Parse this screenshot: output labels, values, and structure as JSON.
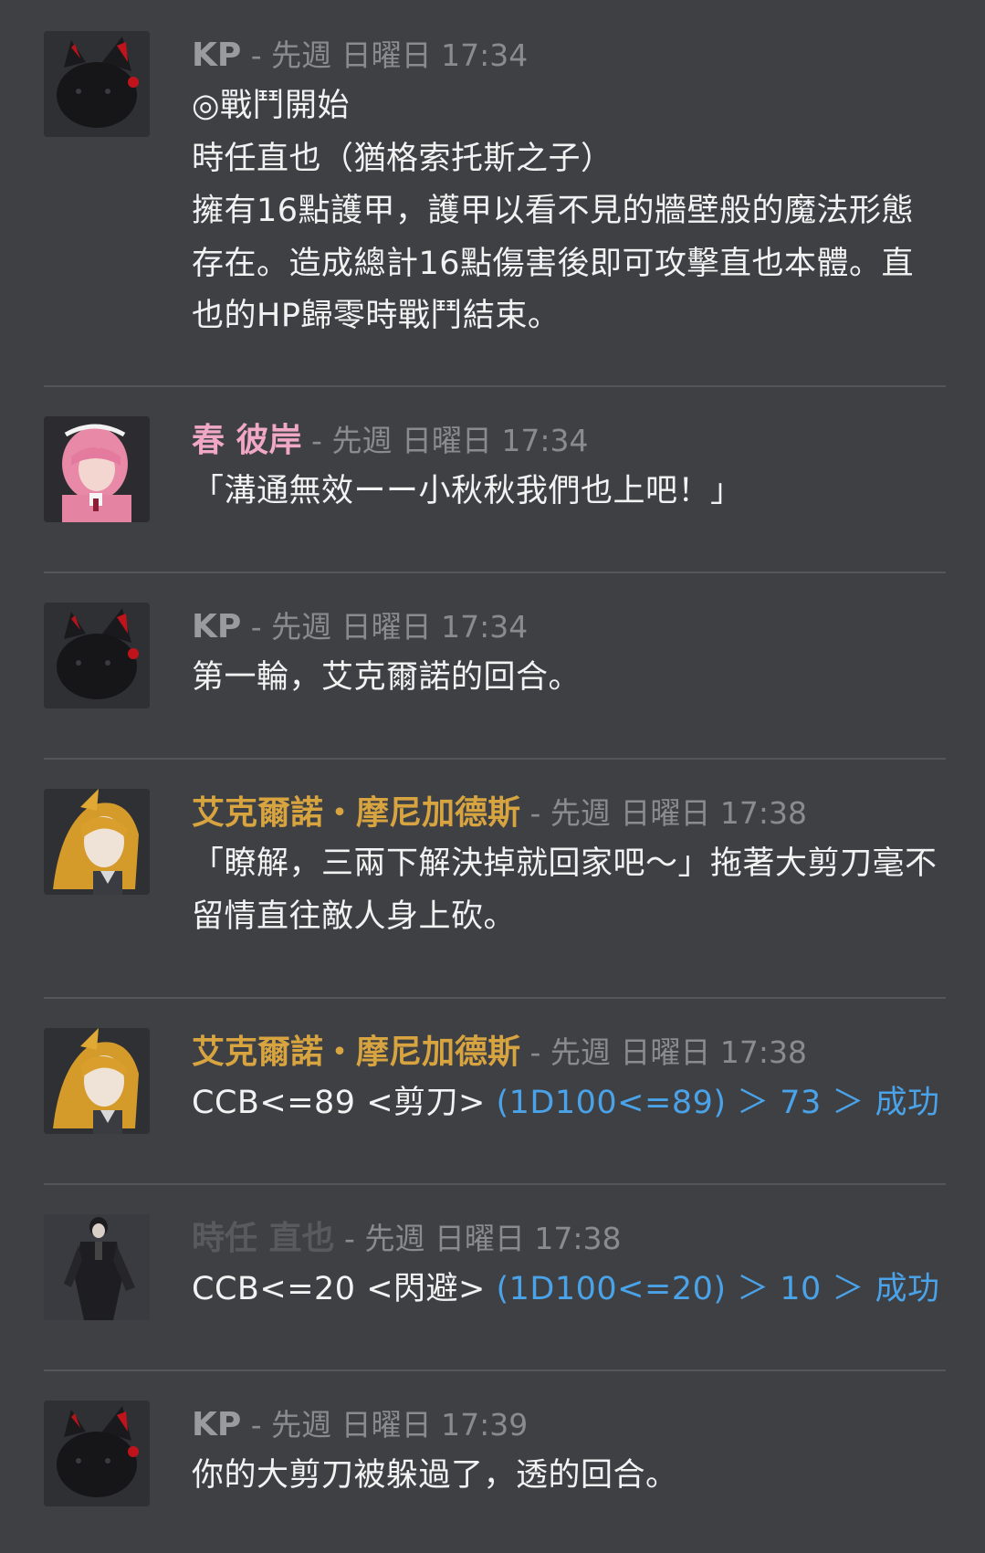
{
  "colors": {
    "background": "#3f4044",
    "divider": "#55565a",
    "kp": "#9a9b9f",
    "haru": "#f1a7c6",
    "eck": "#d7a440",
    "tokito": "#595a5e",
    "roll": "#4aa3e8"
  },
  "messages": [
    {
      "author": "KP",
      "author_color": "#9a9b9f",
      "avatar": "black-cat-avatar",
      "sep": " - ",
      "time": "先週 日曜日 17:34",
      "text": "◎戰鬥開始\n時任直也（猶格索托斯之子）\n擁有16點護甲，護甲以看不見的牆壁般的魔法形態存在。造成總計16點傷害後即可攻擊直也本體。直也的HP歸零時戰鬥結束。"
    },
    {
      "author": "春 彼岸",
      "author_color": "#f1a7c6",
      "avatar": "pink-hair-avatar",
      "sep": " - ",
      "time": "先週 日曜日 17:34",
      "text": "「溝通無效ーー小秋秋我們也上吧！」"
    },
    {
      "author": "KP",
      "author_color": "#9a9b9f",
      "avatar": "black-cat-avatar",
      "sep": " - ",
      "time": "先週 日曜日 17:34",
      "text": "第一輪，艾克爾諾的回合。"
    },
    {
      "author": "艾克爾諾・摩尼加德斯",
      "author_color": "#d7a440",
      "avatar": "blonde-hair-avatar",
      "sep": " - ",
      "time": "先週 日曜日 17:38",
      "text": "「瞭解，三兩下解決掉就回家吧～」拖著大剪刀毫不留情直往敵人身上砍。"
    },
    {
      "author": "艾克爾諾・摩尼加德斯",
      "author_color": "#d7a440",
      "avatar": "blonde-hair-avatar",
      "sep": " - ",
      "time": "先週 日曜日 17:38",
      "text": "CCB<=89 <剪刀> ",
      "roll": "(1D100<=89) ＞ 73 ＞ 成功"
    },
    {
      "author": "時任 直也",
      "author_color": "#595a5e",
      "avatar": "dark-suit-avatar",
      "sep": " - ",
      "time": "先週 日曜日 17:38",
      "text": "CCB<=20 <閃避> ",
      "roll": "(1D100<=20) ＞ 10 ＞ 成功"
    },
    {
      "author": "KP",
      "author_color": "#9a9b9f",
      "avatar": "black-cat-avatar",
      "sep": " - ",
      "time": "先週 日曜日 17:39",
      "text": "你的大剪刀被躲過了，透的回合。"
    }
  ]
}
